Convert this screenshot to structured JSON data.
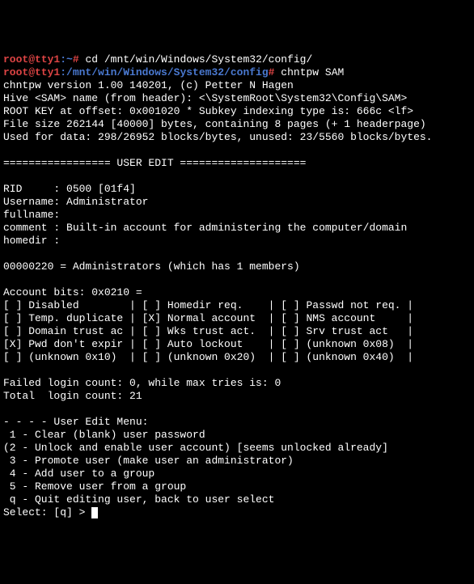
{
  "prompt1_user": "root@tty1",
  "prompt1_path": ":~",
  "prompt1_hash": "#",
  "cmd1": " cd /mnt/win/Windows/System32/config/",
  "prompt2_user": "root@tty1",
  "prompt2_path": ":/mnt/win/Windows/System32/config",
  "prompt2_hash": "#",
  "cmd2": " chntpw SAM",
  "out": {
    "l1": "chntpw version 1.00 140201, (c) Petter N Hagen",
    "l2": "Hive <SAM> name (from header): <\\SystemRoot\\System32\\Config\\SAM>",
    "l3": "ROOT KEY at offset: 0x001020 * Subkey indexing type is: 666c <lf>",
    "l4": "File size 262144 [40000] bytes, containing 8 pages (+ 1 headerpage)",
    "l5": "Used for data: 298/26952 blocks/bytes, unused: 23/5560 blocks/bytes.",
    "l6": "",
    "l7": "================= USER EDIT ====================",
    "l8": "",
    "l9": "RID     : 0500 [01f4]",
    "l10": "Username: Administrator",
    "l11": "fullname:",
    "l12": "comment : Built-in account for administering the computer/domain",
    "l13": "homedir :",
    "l14": "",
    "l15": "00000220 = Administrators (which has 1 members)",
    "l16": "",
    "l17": "Account bits: 0x0210 =",
    "l18": "[ ] Disabled        | [ ] Homedir req.    | [ ] Passwd not req. |",
    "l19": "[ ] Temp. duplicate | [X] Normal account  | [ ] NMS account     |",
    "l20": "[ ] Domain trust ac | [ ] Wks trust act.  | [ ] Srv trust act   |",
    "l21": "[X] Pwd don't expir | [ ] Auto lockout    | [ ] (unknown 0x08)  |",
    "l22": "[ ] (unknown 0x10)  | [ ] (unknown 0x20)  | [ ] (unknown 0x40)  |",
    "l23": "",
    "l24": "Failed login count: 0, while max tries is: 0",
    "l25": "Total  login count: 21",
    "l26": "",
    "l27": "- - - - User Edit Menu:",
    "l28": " 1 - Clear (blank) user password",
    "l29": "(2 - Unlock and enable user account) [seems unlocked already]",
    "l30": " 3 - Promote user (make user an administrator)",
    "l31": " 4 - Add user to a group",
    "l32": " 5 - Remove user from a group",
    "l33": " q - Quit editing user, back to user select"
  },
  "select_prompt": "Select: [q] > "
}
